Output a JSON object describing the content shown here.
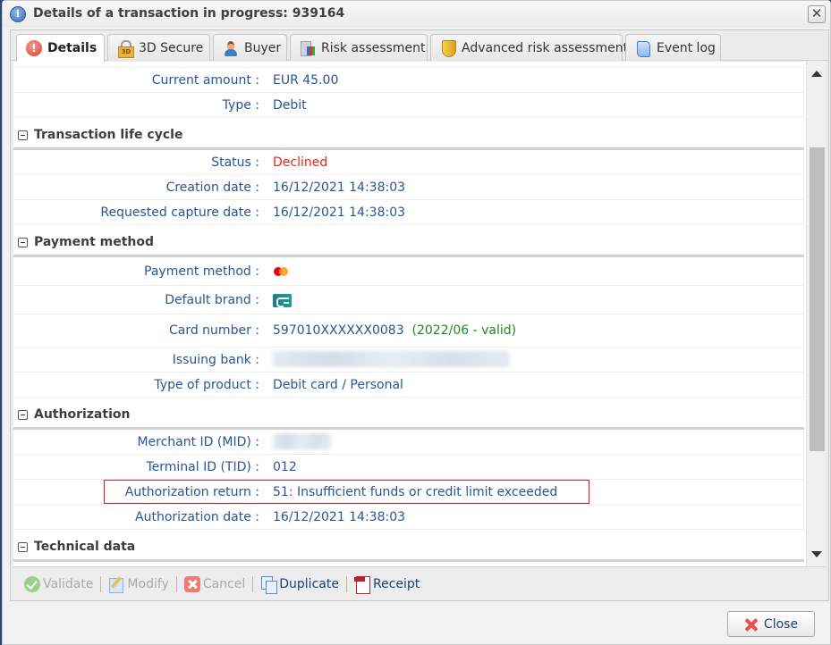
{
  "window": {
    "title": "Details of a transaction in progress: 939164",
    "close_glyph": "✕"
  },
  "tabs": [
    {
      "label": "Details",
      "icon": "alert-icon",
      "active": true
    },
    {
      "label": "3D Secure",
      "icon": "lock-3d-icon",
      "active": false
    },
    {
      "label": "Buyer",
      "icon": "user-icon",
      "active": false
    },
    {
      "label": "Risk assessment",
      "icon": "risk-chart-icon",
      "active": false
    },
    {
      "label": "Advanced risk assessment",
      "icon": "shield-icon",
      "active": false
    },
    {
      "label": "Event log",
      "icon": "scroll-icon",
      "active": false
    }
  ],
  "details": {
    "current_amount": {
      "label": "Current amount :",
      "value": "EUR 45.00"
    },
    "type": {
      "label": "Type :",
      "value": "Debit"
    }
  },
  "sections": {
    "life_cycle": {
      "title": "Transaction life cycle",
      "status": {
        "label": "Status :",
        "value": "Declined",
        "color": "#e8241d"
      },
      "creation_date": {
        "label": "Creation date :",
        "value": "16/12/2021 14:38:03"
      },
      "requested_capture_date": {
        "label": "Requested capture date :",
        "value": "16/12/2021 14:38:03"
      }
    },
    "payment_method": {
      "title": "Payment method",
      "payment_method": {
        "label": "Payment method :",
        "value_icon": "mastercard-icon"
      },
      "default_brand": {
        "label": "Default brand :",
        "value_icon": "cb-card-icon"
      },
      "card_number": {
        "label": "Card number :",
        "value": "597010XXXXXX0083",
        "expiry": "(2022/06 - valid)"
      },
      "issuing_bank": {
        "label": "Issuing bank :",
        "value": "[blurred]"
      },
      "product_type": {
        "label": "Type of product :",
        "value": "Debit card / Personal"
      }
    },
    "authorization": {
      "title": "Authorization",
      "mid": {
        "label": "Merchant ID (MID) :",
        "value": "[blurred]"
      },
      "tid": {
        "label": "Terminal ID (TID) :",
        "value": "012"
      },
      "auth_return": {
        "label": "Authorization return :",
        "value": "51: Insufficient funds or credit limit exceeded",
        "highlighted": true
      },
      "auth_date": {
        "label": "Authorization date :",
        "value": "16/12/2021 14:38:03"
      }
    },
    "technical": {
      "title": "Technical data"
    }
  },
  "toolbar": {
    "validate": {
      "label": "Validate",
      "enabled": false
    },
    "modify": {
      "label": "Modify",
      "enabled": false
    },
    "cancel": {
      "label": "Cancel",
      "enabled": false
    },
    "duplicate": {
      "label": "Duplicate",
      "enabled": true
    },
    "receipt": {
      "label": "Receipt",
      "enabled": true
    }
  },
  "footer": {
    "close_label": "Close"
  },
  "colors": {
    "label_blue": "#2a5594",
    "declined_red": "#e8241d",
    "valid_green": "#1d8a1d",
    "highlight_border": "#d81c1c"
  }
}
